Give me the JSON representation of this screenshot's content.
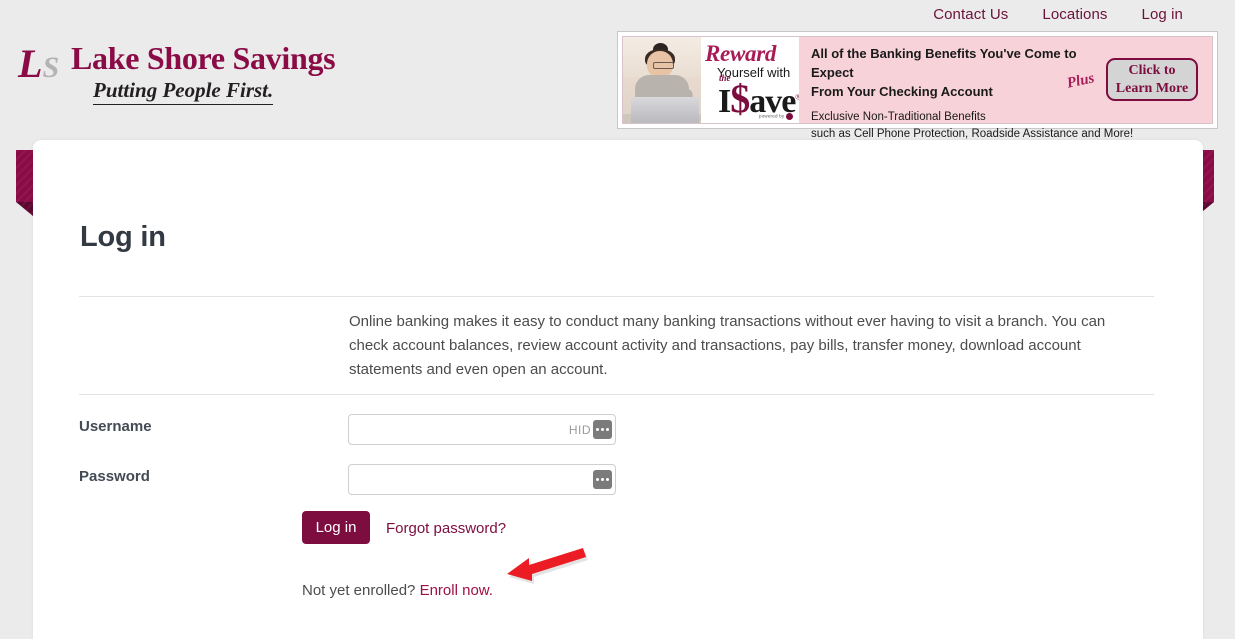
{
  "topnav": {
    "items": [
      {
        "label": "Contact Us",
        "name": "nav-contact-us"
      },
      {
        "label": "Locations",
        "name": "nav-locations"
      },
      {
        "label": "Log in",
        "name": "nav-log-in"
      }
    ]
  },
  "brand": {
    "mark_l": "L",
    "mark_s": "S",
    "name": "Lake Shore Savings",
    "tagline": "Putting People First.",
    "primary_color": "#8a0b46",
    "accent_gray": "#b3b3b3"
  },
  "promo": {
    "reward": "Reward",
    "yourself_with": "Yourself with",
    "isave_mini": "the",
    "isave_i": "I",
    "isave_dollar": "$",
    "isave_ave": "ave",
    "isave_tm": "®",
    "powered_by": "powered by",
    "headline_line1": "All of the Banking Benefits You've Come to Expect",
    "headline_line2": "From Your Checking Account",
    "plus": "Plus",
    "sub_line1": "Exclusive Non-Traditional Benefits",
    "sub_line2": "such as Cell Phone Protection, Roadside Assistance and More!",
    "cta_line1": "Click to",
    "cta_line2": "Learn More",
    "background_color": "#f7d3d9"
  },
  "page": {
    "title": "Log in",
    "intro": "Online banking makes it easy to conduct many banking transactions without ever having to visit a branch. You can check account balances, review account activity and transactions, pay bills, transfer money, download account statements and even open an account."
  },
  "form": {
    "username_label": "Username",
    "username_value": "",
    "username_placeholder": "",
    "password_manager_hint": "HID",
    "password_label": "Password",
    "password_value": "",
    "password_placeholder": "",
    "login_button": "Log in",
    "forgot_password": "Forgot password?",
    "enroll_prompt": "Not yet enrolled?",
    "enroll_link": "Enroll now.",
    "button_color": "#7d0d3f"
  },
  "annotation": {
    "arrow_color": "#ec1c24",
    "points_at": "Enroll now."
  }
}
